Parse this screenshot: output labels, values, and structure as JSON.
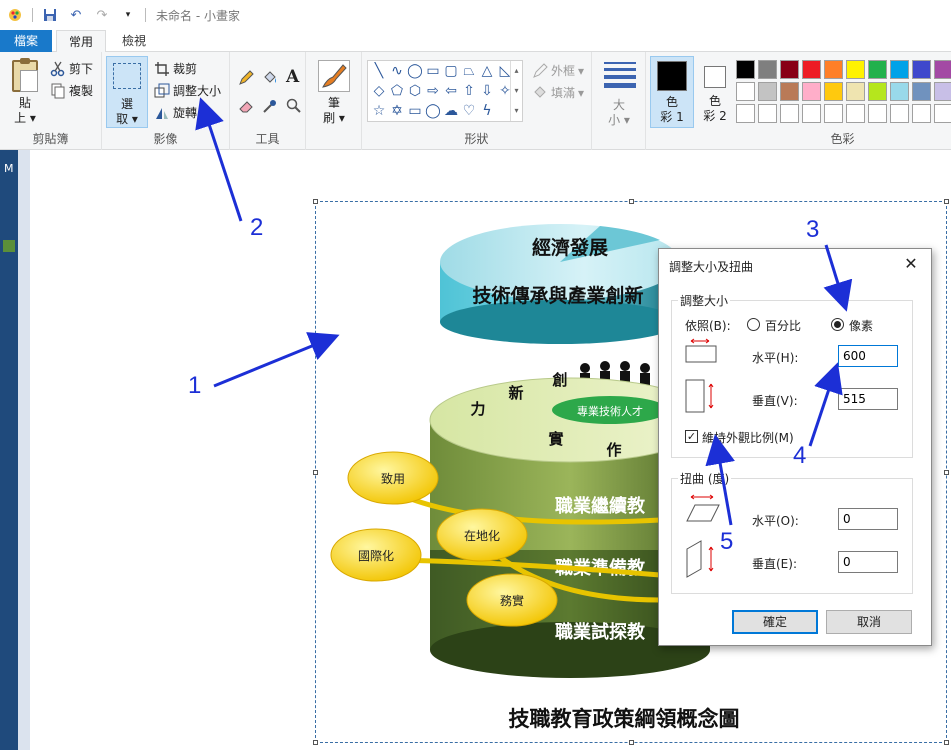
{
  "app": {
    "title": "未命名 - 小畫家"
  },
  "tabs": {
    "file": "檔案",
    "home": "常用",
    "view": "檢視"
  },
  "ribbon": {
    "clipboard": {
      "paste": "貼",
      "paste2": "上",
      "cut": "剪下",
      "copy": "複製",
      "label": "剪貼簿"
    },
    "image": {
      "select": "選",
      "select2": "取",
      "crop": "裁剪",
      "resize": "調整大小",
      "rotate": "旋轉",
      "label": "影像"
    },
    "tools": {
      "label": "工具"
    },
    "brushes": {
      "label": "筆",
      "label2": "刷"
    },
    "shapes": {
      "outline": "外框",
      "fill": "填滿",
      "label": "形狀"
    },
    "size": {
      "label": "大",
      "label2": "小"
    },
    "color1": {
      "label": "色",
      "label2": "彩 1"
    },
    "color2": {
      "label": "色",
      "label2": "彩 2"
    },
    "colors": {
      "label": "色彩",
      "palette_row1": [
        "#000000",
        "#7f7f7f",
        "#880015",
        "#ed1c24",
        "#ff7f27",
        "#fff200",
        "#22b14c",
        "#00a2e8",
        "#3f48cc",
        "#a349a4"
      ],
      "palette_row2": [
        "#ffffff",
        "#c3c3c3",
        "#b97a57",
        "#ffaec9",
        "#ffc90e",
        "#efe4b0",
        "#b5e61d",
        "#99d9ea",
        "#7092be",
        "#c8bfe7"
      ],
      "color1_value": "#000000",
      "color2_value": "#ffffff"
    }
  },
  "diagram": {
    "top": "經濟發展",
    "tier1": "技術傳承與產業創新",
    "ring_chars": [
      "創",
      "新",
      "力",
      "實",
      "作"
    ],
    "center": "專業技術人才",
    "band1": "職業繼續教",
    "band2": "職業準備教",
    "band3": "職業試探教",
    "oval1": "致用",
    "oval2": "國際化",
    "oval3": "在地化",
    "oval4": "務實",
    "caption": "技職教育政策綱領概念圖"
  },
  "dialog": {
    "title": "調整大小及扭曲",
    "resize_legend": "調整大小",
    "by_label": "依照(B):",
    "percent": "百分比",
    "pixels": "像素",
    "horizontal": "水平(H):",
    "horizontal_value": "600",
    "vertical": "垂直(V):",
    "vertical_value": "515",
    "keep_ratio": "維持外觀比例(M)",
    "skew_legend": "扭曲 (度)",
    "skew_h": "水平(O):",
    "skew_h_value": "0",
    "skew_v": "垂直(E):",
    "skew_v_value": "0",
    "ok": "確定",
    "cancel": "取消"
  },
  "annotations": [
    "1",
    "2",
    "3",
    "4",
    "5"
  ]
}
